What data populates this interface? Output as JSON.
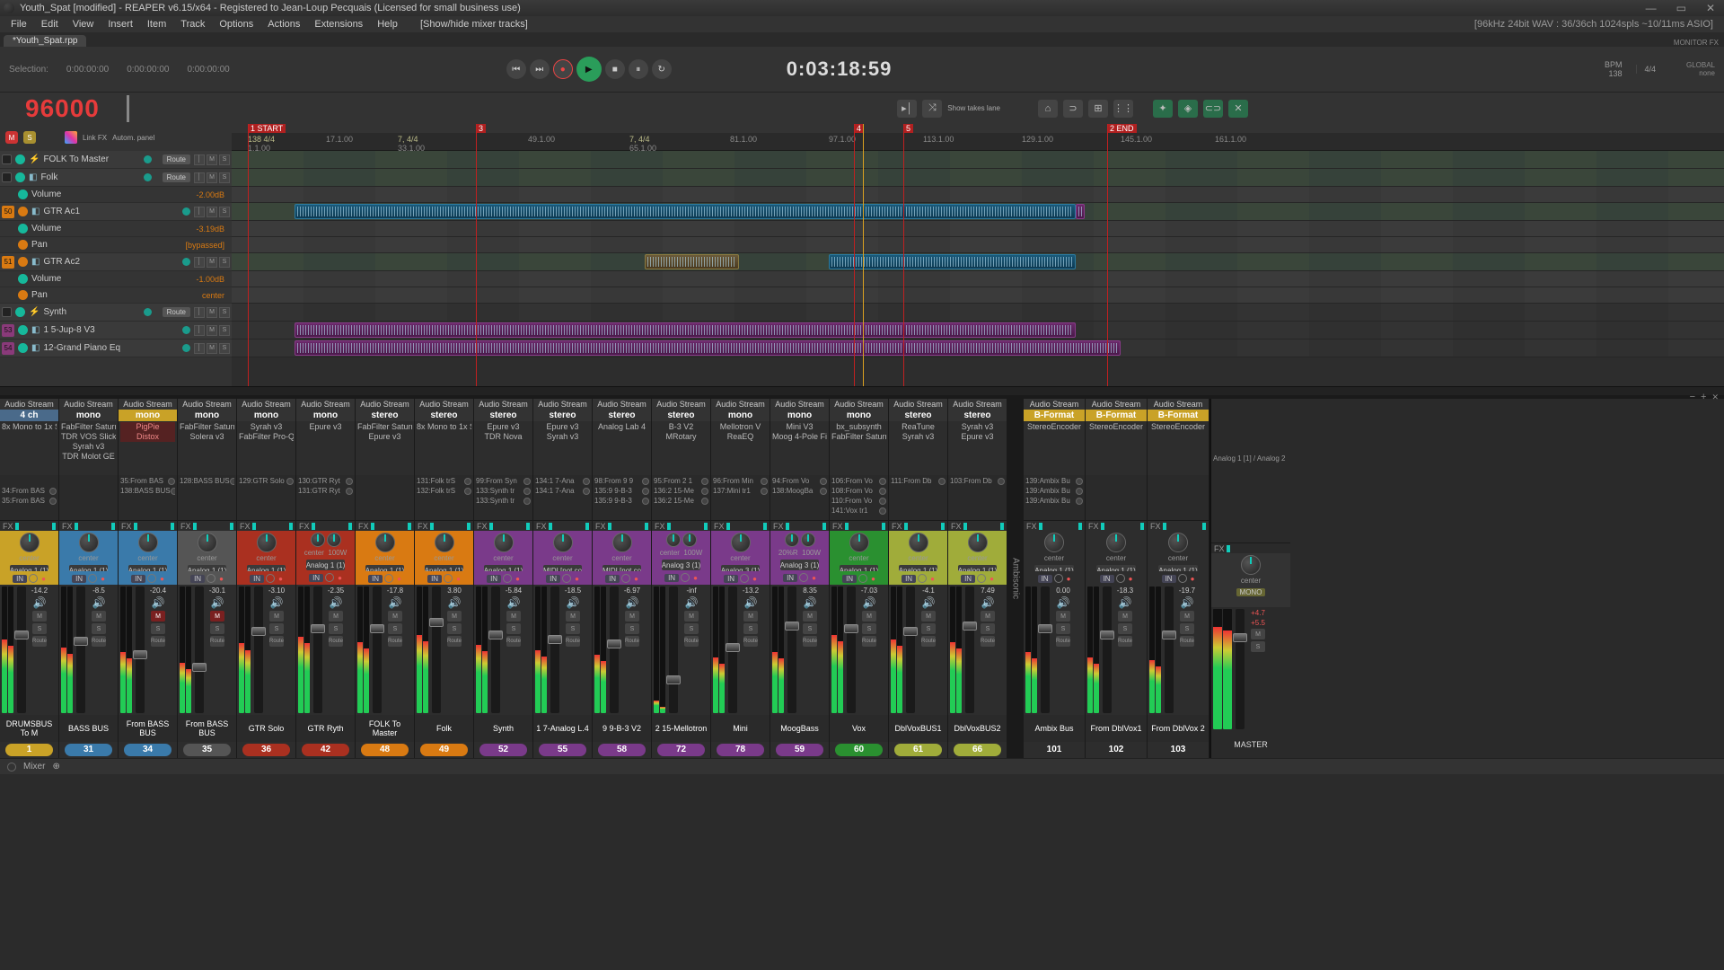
{
  "window": {
    "title": "Youth_Spat [modified] - REAPER v6.15/x64 - Registered to Jean-Loup Pecquais (Licensed for small business use)"
  },
  "menu": [
    "File",
    "Edit",
    "View",
    "Insert",
    "Item",
    "Track",
    "Options",
    "Actions",
    "Extensions",
    "Help",
    "   [Show/hide mixer tracks]"
  ],
  "menu_right": "[96kHz 24bit WAV : 36/36ch 1024spls ~10/11ms ASIO]",
  "monitor_fx": "MONITOR FX",
  "global_label": "GLOBAL",
  "none_label": "none",
  "tab": "*Youth_Spat.rpp",
  "selection": {
    "label": "Selection:",
    "a": "0:00:00:00",
    "b": "0:00:00:00",
    "c": "0:00:00:00"
  },
  "timecode": "0:03:18:59",
  "bpm": {
    "label": "BPM",
    "value": "138",
    "sig": "4/4"
  },
  "tempo": "96000",
  "tcp_icons": {
    "link": "Link\nFX",
    "autom": "Autom.\npanel"
  },
  "toolbar2_right": "Show\ntakes lane",
  "markers": [
    {
      "pos": 18,
      "cls": "r",
      "label": "1 START"
    },
    {
      "pos": 272,
      "cls": "r",
      "label": "3"
    },
    {
      "pos": 693,
      "cls": "r",
      "label": "4"
    },
    {
      "pos": 748,
      "cls": "r",
      "label": "5"
    },
    {
      "pos": 975,
      "cls": "r",
      "label": "2 END"
    }
  ],
  "ticks": [
    {
      "pos": 18,
      "t1": "138 4/4",
      "t2": "1.1.00"
    },
    {
      "pos": 105,
      "t1": "",
      "t2": "17.1.00"
    },
    {
      "pos": 185,
      "t1": "7, 4/4",
      "t2": "33.1.00"
    },
    {
      "pos": 330,
      "t1": "",
      "t2": "49.1.00"
    },
    {
      "pos": 443,
      "t1": "7, 4/4",
      "t2": "65.1.00"
    },
    {
      "pos": 555,
      "t1": "",
      "t2": "81.1.00"
    },
    {
      "pos": 665,
      "t1": "",
      "t2": "97.1.00"
    },
    {
      "pos": 770,
      "t1": "",
      "t2": "113.1.00"
    },
    {
      "pos": 880,
      "t1": "",
      "t2": "129.1.00"
    },
    {
      "pos": 990,
      "t1": "",
      "t2": "145.1.00"
    },
    {
      "pos": 1095,
      "t1": "",
      "t2": "161.1.00"
    }
  ],
  "tracks": [
    {
      "type": "fx",
      "name": "FOLK To Master",
      "route": true
    },
    {
      "type": "main",
      "name": "Folk",
      "route": true,
      "dot": "g"
    },
    {
      "type": "sub",
      "name": "Volume",
      "val": "-2.00dB"
    },
    {
      "type": "trk",
      "num": "50",
      "numc": "o",
      "name": "GTR Ac1",
      "dot": "o"
    },
    {
      "type": "sub",
      "name": "Volume",
      "val": "-3.19dB"
    },
    {
      "type": "sub",
      "name": "Pan",
      "val": "[bypassed]"
    },
    {
      "type": "trk",
      "num": "51",
      "numc": "o",
      "name": "GTR Ac2",
      "dot": "o"
    },
    {
      "type": "sub",
      "name": "Volume",
      "val": "-1.00dB"
    },
    {
      "type": "sub",
      "name": "Pan",
      "val": "center"
    },
    {
      "type": "fx",
      "name": "Synth",
      "route": true
    },
    {
      "type": "trk",
      "num": "53",
      "numc": "p",
      "name": "1 5-Jup-8 V3"
    },
    {
      "type": "trk",
      "num": "54",
      "numc": "p",
      "name": "12-Grand Piano Eq"
    }
  ],
  "fx_label": "FX",
  "route_label": "Route",
  "in_label": "IN",
  "m_label": "M",
  "s_label": "S",
  "channels": [
    {
      "name": "DRUMSBUS To M",
      "num": "1",
      "color": "#c9a227",
      "badge": "4 ch",
      "bcolor": "#4a6a8a",
      "fx": [
        "8x Mono to 1x Ster"
      ],
      "sends": [
        "",
        "34:From BAS",
        "35:From BAS"
      ],
      "db": "-14.2",
      "mh": 58,
      "fh": 35,
      "slot": "Analog 1 (1)",
      "pan": "center"
    },
    {
      "name": "BASS BUS",
      "num": "31",
      "color": "#3a7aaa",
      "badge": "mono",
      "bcolor": "#333",
      "fx": [
        "FabFilter Saturn",
        "TDR VOS SlickEQ",
        "Syrah v3",
        "TDR Molot GE"
      ],
      "sends": [
        ""
      ],
      "db": "-8.5",
      "mh": 52,
      "fh": 40,
      "slot": "Analog 1 (1)",
      "pan": "center"
    },
    {
      "name": "From BASS BUS",
      "num": "34",
      "color": "#3a7aaa",
      "badge": "mono",
      "bcolor": "#c9a227",
      "fx": [
        "PigPie",
        "Distox"
      ],
      "fxhi": true,
      "sends": [
        "35:From BAS",
        "138:BASS BUS"
      ],
      "db": "-20.4",
      "mh": 48,
      "fh": 50,
      "slot": "Analog 1 (1)",
      "pan": "center",
      "mred": true
    },
    {
      "name": "From BASS BUS",
      "num": "35",
      "color": "#555",
      "badge": "mono",
      "bcolor": "#333",
      "fx": [
        "FabFilter Saturn",
        "Solera v3"
      ],
      "sends": [
        "128:BASS BUS"
      ],
      "db": "-30.1",
      "mh": 40,
      "fh": 60,
      "slot": "Analog 1 (1)",
      "pan": "center",
      "mred": true
    },
    {
      "name": "GTR Solo",
      "num": "36",
      "color": "#aa3020",
      "badge": "mono",
      "bcolor": "#333",
      "fx": [
        "Syrah v3",
        "FabFilter Pro-Q"
      ],
      "sends": [
        "129:GTR Solo"
      ],
      "db": "-3.10",
      "mh": 55,
      "fh": 32,
      "slot": "Analog 1 (1)",
      "pan": "center"
    },
    {
      "name": "GTR Ryth",
      "num": "42",
      "color": "#aa3020",
      "badge": "mono",
      "bcolor": "#333",
      "fx": [
        "Epure v3"
      ],
      "sends": [
        "130:GTR Ryt",
        "131:GTR Ryt"
      ],
      "db": "-2.35",
      "mh": 60,
      "fh": 30,
      "slot": "Analog 1 (1)",
      "pan": "center",
      "pan2": "100W"
    },
    {
      "name": "FOLK To Master",
      "num": "48",
      "color": "#d97a12",
      "badge": "stereo",
      "bcolor": "#333",
      "fx": [
        "FabFilter Saturn",
        "Epure v3"
      ],
      "sends": [
        ""
      ],
      "db": "-17.8",
      "mh": 56,
      "fh": 30,
      "slot": "Analog 1 (1)",
      "pan": "center"
    },
    {
      "name": "Folk",
      "num": "49",
      "color": "#d97a12",
      "badge": "stereo",
      "bcolor": "#333",
      "fx": [
        "8x Mono to 1x Ste"
      ],
      "sends": [
        "131:Folk trS",
        "132:Folk trS"
      ],
      "db": "3.80",
      "mh": 62,
      "fh": 25,
      "slot": "Analog 1 (1)",
      "pan": "center"
    },
    {
      "name": "Synth",
      "num": "52",
      "color": "#7a3a8a",
      "badge": "stereo",
      "bcolor": "#333",
      "fx": [
        "Epure v3",
        "TDR Nova"
      ],
      "sends": [
        "99:From Syn",
        "133:Synth tr",
        "133:Synth tr"
      ],
      "db": "-5.84",
      "mh": 54,
      "fh": 35,
      "slot": "Analog 1 (1)",
      "pan": "center"
    },
    {
      "name": "1 7-Analog L.4",
      "num": "55",
      "color": "#7a3a8a",
      "badge": "stereo",
      "bcolor": "#333",
      "fx": [
        "Epure v3",
        "Syrah v3"
      ],
      "sends": [
        "134:1 7-Ana",
        "134:1 7-Ana"
      ],
      "db": "-18.5",
      "mh": 50,
      "fh": 38,
      "slot": "MIDI [not co",
      "pan": "center"
    },
    {
      "name": "9 9-B-3 V2",
      "num": "58",
      "color": "#7a3a8a",
      "badge": "stereo",
      "bcolor": "#333",
      "fx": [
        "Analog Lab 4"
      ],
      "sends": [
        "98:From 9 9",
        "135:9 9-B-3",
        "135:9 9-B-3"
      ],
      "db": "-6.97",
      "mh": 46,
      "fh": 42,
      "slot": "MIDI [not co",
      "pan": "center"
    },
    {
      "name": "2 15-Mellotron",
      "num": "72",
      "color": "#7a3a8a",
      "badge": "stereo",
      "bcolor": "#333",
      "fx": [
        "B-3 V2",
        "MRotary"
      ],
      "sends": [
        "95:From 2 1",
        "136:2 15-Me",
        "136:2 15-Me"
      ],
      "db": "-inf",
      "mh": 10,
      "fh": 70,
      "slot": "Analog 3 (1)",
      "pan": "center",
      "pan2": "100W"
    },
    {
      "name": "Mini",
      "num": "78",
      "color": "#7a3a8a",
      "badge": "mono",
      "bcolor": "#333",
      "fx": [
        "Mellotron V",
        "ReaEQ"
      ],
      "sends": [
        "96:From Min",
        "137:Mini tr1"
      ],
      "db": "-13.2",
      "mh": 44,
      "fh": 45,
      "slot": "Analog 3 (1)",
      "pan": "center"
    },
    {
      "name": "MoogBass",
      "num": "59",
      "color": "#7a3a8a",
      "badge": "mono",
      "bcolor": "#333",
      "fx": [
        "Mini V3",
        "Moog 4-Pole Fil"
      ],
      "sends": [
        "94:From Vo",
        "138:MoogBa"
      ],
      "db": "8.35",
      "mh": 48,
      "fh": 28,
      "slot": "Analog 3 (1)",
      "pan": "20%R",
      "pan2": "100W"
    },
    {
      "name": "Vox",
      "num": "60",
      "color": "#2a9030",
      "badge": "mono",
      "bcolor": "#333",
      "fx": [
        "bx_subsynth",
        "FabFilter Saturn"
      ],
      "sends": [
        "106:From Vo",
        "108:From Vo",
        "110:From Vo",
        "141:Vox tr1"
      ],
      "db": "-7.03",
      "mh": 62,
      "fh": 30,
      "slot": "Analog 1 (1)",
      "pan": "center"
    },
    {
      "name": "DblVoxBUS1",
      "num": "61",
      "color": "#a0ac3a",
      "badge": "stereo",
      "bcolor": "#333",
      "fx": [
        "ReaTune",
        "Syrah v3"
      ],
      "sends": [
        "111:From Db"
      ],
      "db": "-4.1",
      "mh": 58,
      "fh": 32,
      "slot": "Analog 1 (1)",
      "pan": "center"
    },
    {
      "name": "DblVoxBUS2",
      "num": "66",
      "color": "#a0ac3a",
      "badge": "stereo",
      "bcolor": "#333",
      "fx": [
        "Syrah v3",
        "Epure v3"
      ],
      "sends": [
        "103:From Db"
      ],
      "db": "7.49",
      "mh": 56,
      "fh": 28,
      "slot": "Analog 1 (1)",
      "pan": "center"
    }
  ],
  "ambi_label": "Ambisonic",
  "ambi_channels": [
    {
      "name": "Ambix Bus",
      "num": "101",
      "badge": "B-Format",
      "bcolor": "#c9a227",
      "fx": [
        "StereoEncoder"
      ],
      "sends": [
        "139:Ambix Bu",
        "139:Ambix Bu",
        "139:Ambix Bu"
      ],
      "db": "0.00",
      "mh": 48,
      "fh": 30,
      "slot": "Analog 1 (1)",
      "pan": "center"
    },
    {
      "name": "From DblVox1",
      "num": "102",
      "badge": "B-Format",
      "bcolor": "#c9a227",
      "fx": [
        "StereoEncoder"
      ],
      "sends": [],
      "db": "-18.3",
      "mh": 44,
      "fh": 35,
      "slot": "Analog 1 (1)",
      "pan": "center"
    },
    {
      "name": "From DblVox 2",
      "num": "103",
      "badge": "B-Format",
      "bcolor": "#c9a227",
      "fx": [
        "StereoEncoder"
      ],
      "sends": [],
      "db": "-19.7",
      "mh": 42,
      "fh": 35,
      "slot": "Analog 1 (1)",
      "pan": "center"
    }
  ],
  "master": {
    "name": "MASTER",
    "slot": "Analog 1 [1] / Analog 2",
    "db": "+5.5",
    "db2": "+4.7",
    "pan": "center",
    "fx": "FX",
    "mono": "MONO"
  },
  "status": {
    "mixer": "Mixer"
  },
  "extra_ctrl": "+"
}
